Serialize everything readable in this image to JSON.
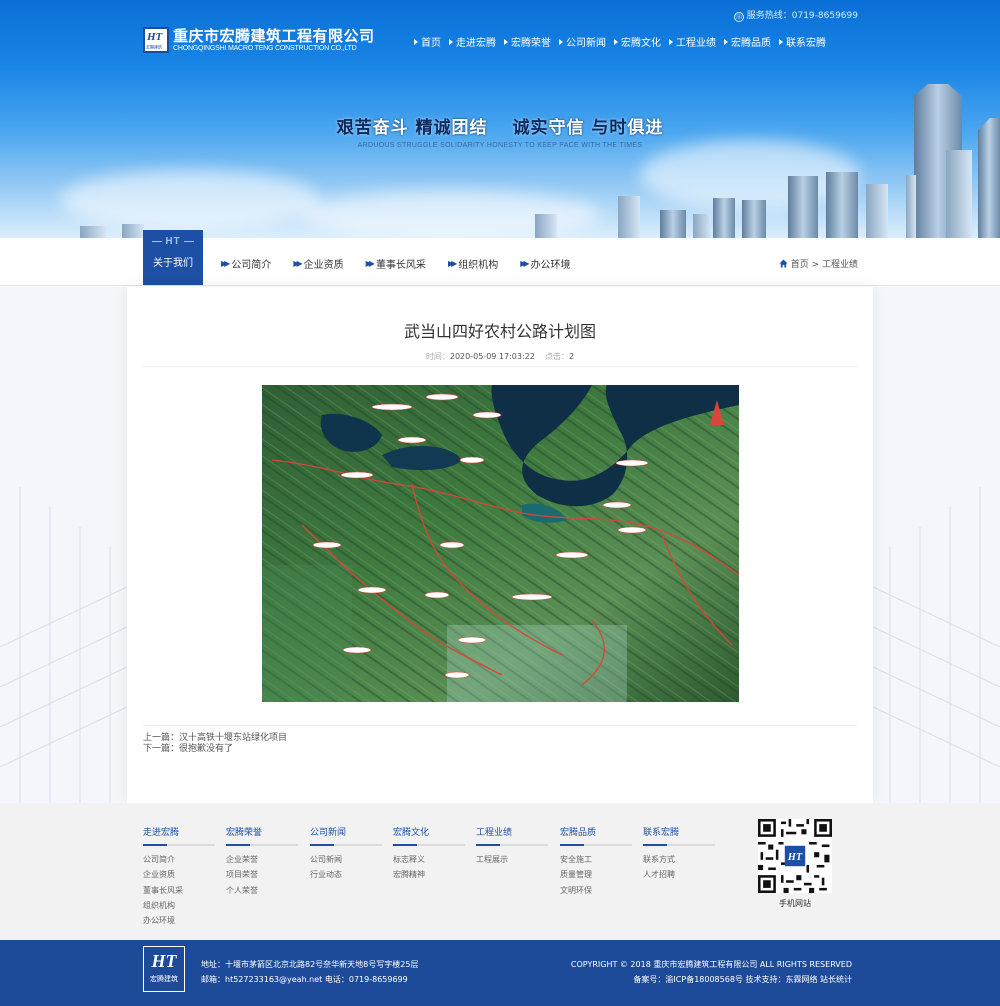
{
  "header": {
    "logo_cn": "重庆市宏腾建筑工程有限公司",
    "logo_en": "CHONGQINGSHI MACRO TENG CONSTRUCTION CO.,LTD",
    "logo_badge": "HT",
    "logo_badge_sub": "宏腾建筑",
    "hotline": "服务热线：0719-8659699",
    "nav": [
      "首页",
      "走进宏腾",
      "宏腾荣誉",
      "公司新闻",
      "宏腾文化",
      "工程业绩",
      "宏腾品质",
      "联系宏腾"
    ]
  },
  "banner": {
    "slogan_parts": [
      "艰苦",
      "奋斗",
      " 精诚",
      "团结",
      "　 诚实",
      "守信",
      " 与时",
      "俱进"
    ],
    "slogan_en": "ARDUOUS STRUGGLE SOLIDARITY HONESTY TO KEEP PACE WITH THE TIMES"
  },
  "subnav": {
    "tab_tag": "HT",
    "tab_label": "关于我们",
    "items": [
      "公司简介",
      "企业资质",
      "董事长风采",
      "组织机构",
      "办公环境"
    ],
    "breadcrumb": "首页 > 工程业绩"
  },
  "article": {
    "title": "武当山四好农村公路计划图",
    "time_label": "时间：",
    "time": "2020-05-09 17:03:22",
    "clicks_label": "点击：",
    "clicks": "2",
    "prev": "上一篇：汉十高铁十堰东站绿化项目",
    "next": "下一篇：很抱歉没有了"
  },
  "footer": {
    "columns": [
      {
        "head": "走进宏腾",
        "items": [
          "公司简介",
          "企业资质",
          "董事长风采",
          "组织机构",
          "办公环境"
        ]
      },
      {
        "head": "宏腾荣誉",
        "items": [
          "企业荣誉",
          "项目荣誉",
          "个人荣誉"
        ]
      },
      {
        "head": "公司新闻",
        "items": [
          "公司新闻",
          "行业动态"
        ]
      },
      {
        "head": "宏腾文化",
        "items": [
          "标志释义",
          "宏腾精神"
        ]
      },
      {
        "head": "工程业绩",
        "items": [
          "工程展示"
        ]
      },
      {
        "head": "宏腾品质",
        "items": [
          "安全施工",
          "质量管理",
          "文明环保"
        ]
      },
      {
        "head": "联系宏腾",
        "items": [
          "联系方式",
          "人才招聘"
        ]
      }
    ],
    "qr_caption": "手机网站",
    "address": "地址：十堰市茅箭区北京北路82号奈华新天地8号写字楼25层",
    "contact": "邮箱：ht527233163@yeah.net 电话：0719-8659699",
    "copyright": "COPYRIGHT © 2018 重庆市宏腾建筑工程有限公司 ALL RIGHTS RESERVED",
    "icp": "备案号：渝ICP备18008568号 技术支持：东霖网络 站长统计",
    "bottom_logo": "HT",
    "bottom_logo_sub": "宏腾建筑"
  },
  "colors": {
    "brand_blue": "#1d4fa4",
    "footer_blue": "#1d4b99",
    "banner_sky": "#1985e6"
  }
}
